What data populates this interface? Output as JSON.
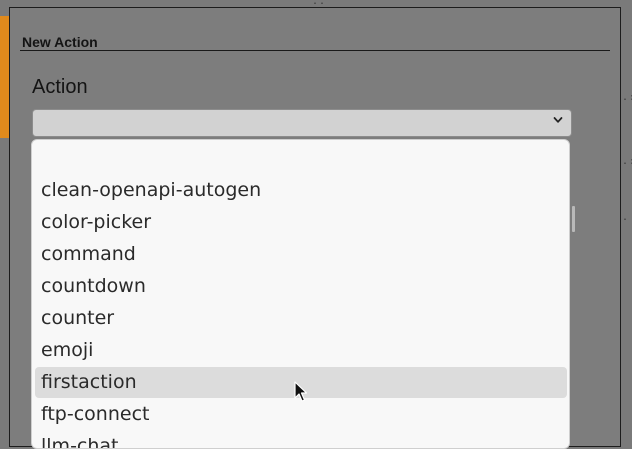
{
  "dialog": {
    "title": "New Action",
    "field_label": "Action",
    "select_value": ""
  },
  "dropdown": {
    "options": [
      {
        "label": ""
      },
      {
        "label": "clean-openapi-autogen"
      },
      {
        "label": "color-picker"
      },
      {
        "label": "command"
      },
      {
        "label": "countdown"
      },
      {
        "label": "counter"
      },
      {
        "label": "emoji"
      },
      {
        "label": "firstaction",
        "hovered": true
      },
      {
        "label": "ftp-connect"
      },
      {
        "label": "llm-chat"
      }
    ]
  },
  "colors": {
    "overlay": "#7a7a7a",
    "accent_tab": "#e08a1c",
    "hover_row": "#dcdcdc",
    "listbox_bg": "#f8f8f8"
  },
  "icons": {
    "select_arrow": "chevron-down-icon",
    "pointer": "mouse-cursor-icon"
  }
}
